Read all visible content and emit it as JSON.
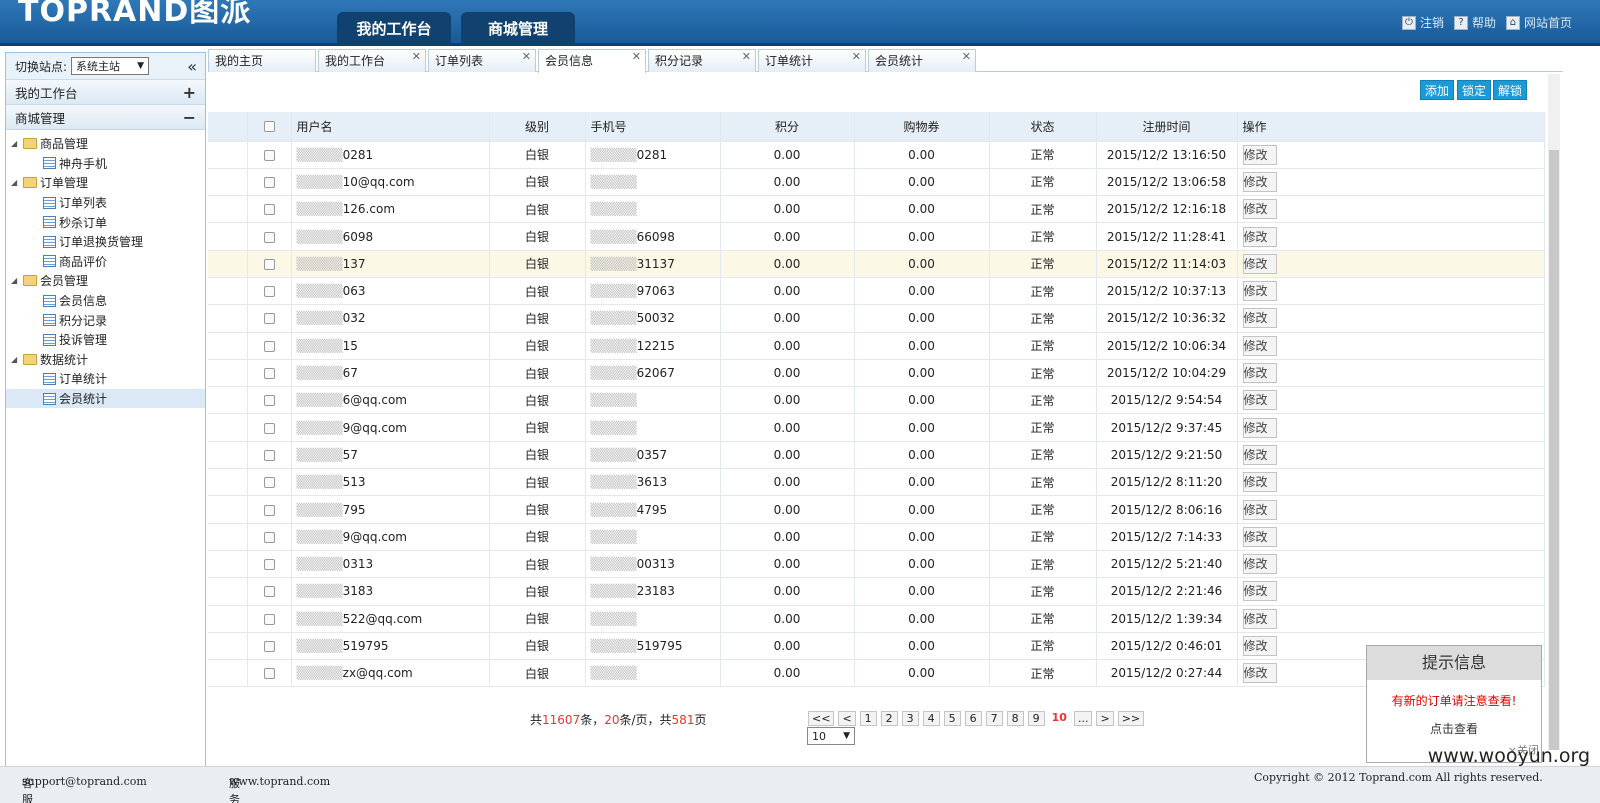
{
  "header": {
    "logo": "TOPRAND图派",
    "tabs": [
      {
        "label": "我的工作台"
      },
      {
        "label": "商城管理"
      }
    ],
    "links": [
      {
        "label": "注销",
        "icon": "power-icon"
      },
      {
        "label": "帮助",
        "icon": "help-icon"
      },
      {
        "label": "网站首页",
        "icon": "home-icon"
      }
    ]
  },
  "sidebar": {
    "site_label": "切换站点:",
    "site_value": "系统主站",
    "collapse_glyph": "«",
    "workbench": "我的工作台",
    "workbench_sign": "+",
    "mall": "商城管理",
    "mall_sign": "−",
    "tree": [
      {
        "label": "商品管理",
        "children": [
          {
            "label": "神舟手机"
          }
        ]
      },
      {
        "label": "订单管理",
        "children": [
          {
            "label": "订单列表"
          },
          {
            "label": "秒杀订单"
          },
          {
            "label": "订单退换货管理"
          },
          {
            "label": "商品评价"
          }
        ]
      },
      {
        "label": "会员管理",
        "children": [
          {
            "label": "会员信息"
          },
          {
            "label": "积分记录"
          },
          {
            "label": "投诉管理"
          }
        ]
      },
      {
        "label": "数据统计",
        "children": [
          {
            "label": "订单统计"
          },
          {
            "label": "会员统计"
          }
        ]
      }
    ]
  },
  "content_tabs": [
    {
      "label": "我的主页",
      "closable": false
    },
    {
      "label": "我的工作台",
      "closable": true
    },
    {
      "label": "订单列表",
      "closable": true
    },
    {
      "label": "会员信息",
      "closable": true,
      "active": true
    },
    {
      "label": "积分记录",
      "closable": true
    },
    {
      "label": "订单统计",
      "closable": true
    },
    {
      "label": "会员统计",
      "closable": true
    }
  ],
  "actions": {
    "add": "添加",
    "lock": "锁定",
    "unlock": "解锁"
  },
  "table": {
    "columns": [
      "用户名",
      "级别",
      "手机号",
      "积分",
      "购物券",
      "状态",
      "注册时间",
      "操作"
    ],
    "edit_label": "修改",
    "rows": [
      {
        "user": "0281",
        "level": "白银",
        "phone": "0281",
        "points": "0.00",
        "coupon": "0.00",
        "status": "正常",
        "time": "2015/12/2 13:16:50"
      },
      {
        "user": "10@qq.com",
        "level": "白银",
        "phone": "",
        "points": "0.00",
        "coupon": "0.00",
        "status": "正常",
        "time": "2015/12/2 13:06:58"
      },
      {
        "user": "126.com",
        "level": "白银",
        "phone": "",
        "points": "0.00",
        "coupon": "0.00",
        "status": "正常",
        "time": "2015/12/2 12:16:18"
      },
      {
        "user": "6098",
        "level": "白银",
        "phone": "66098",
        "points": "0.00",
        "coupon": "0.00",
        "status": "正常",
        "time": "2015/12/2 11:28:41"
      },
      {
        "user": "137",
        "level": "白银",
        "phone": "31137",
        "points": "0.00",
        "coupon": "0.00",
        "status": "正常",
        "time": "2015/12/2 11:14:03"
      },
      {
        "user": "063",
        "level": "白银",
        "phone": "97063",
        "points": "0.00",
        "coupon": "0.00",
        "status": "正常",
        "time": "2015/12/2 10:37:13"
      },
      {
        "user": "032",
        "level": "白银",
        "phone": "50032",
        "points": "0.00",
        "coupon": "0.00",
        "status": "正常",
        "time": "2015/12/2 10:36:32"
      },
      {
        "user": "15",
        "level": "白银",
        "phone": "12215",
        "points": "0.00",
        "coupon": "0.00",
        "status": "正常",
        "time": "2015/12/2 10:06:34"
      },
      {
        "user": "67",
        "level": "白银",
        "phone": "62067",
        "points": "0.00",
        "coupon": "0.00",
        "status": "正常",
        "time": "2015/12/2 10:04:29"
      },
      {
        "user": "6@qq.com",
        "level": "白银",
        "phone": "",
        "points": "0.00",
        "coupon": "0.00",
        "status": "正常",
        "time": "2015/12/2 9:54:54"
      },
      {
        "user": "9@qq.com",
        "level": "白银",
        "phone": "",
        "points": "0.00",
        "coupon": "0.00",
        "status": "正常",
        "time": "2015/12/2 9:37:45"
      },
      {
        "user": "57",
        "level": "白银",
        "phone": "0357",
        "points": "0.00",
        "coupon": "0.00",
        "status": "正常",
        "time": "2015/12/2 9:21:50"
      },
      {
        "user": "513",
        "level": "白银",
        "phone": "3613",
        "points": "0.00",
        "coupon": "0.00",
        "status": "正常",
        "time": "2015/12/2 8:11:20"
      },
      {
        "user": "795",
        "level": "白银",
        "phone": "4795",
        "points": "0.00",
        "coupon": "0.00",
        "status": "正常",
        "time": "2015/12/2 8:06:16"
      },
      {
        "user": "9@qq.com",
        "level": "白银",
        "phone": "",
        "points": "0.00",
        "coupon": "0.00",
        "status": "正常",
        "time": "2015/12/2 7:14:33"
      },
      {
        "user": "0313",
        "level": "白银",
        "phone": "00313",
        "points": "0.00",
        "coupon": "0.00",
        "status": "正常",
        "time": "2015/12/2 5:21:40"
      },
      {
        "user": "3183",
        "level": "白银",
        "phone": "23183",
        "points": "0.00",
        "coupon": "0.00",
        "status": "正常",
        "time": "2015/12/2 2:21:46"
      },
      {
        "user": "522@qq.com",
        "level": "白银",
        "phone": "",
        "points": "0.00",
        "coupon": "0.00",
        "status": "正常",
        "time": "2015/12/2 1:39:34"
      },
      {
        "user": "519795",
        "level": "白银",
        "phone": "519795",
        "points": "0.00",
        "coupon": "0.00",
        "status": "正常",
        "time": "2015/12/2 0:46:01"
      },
      {
        "user": "zx@qq.com",
        "level": "白银",
        "phone": "",
        "points": "0.00",
        "coupon": "0.00",
        "status": "正常",
        "time": "2015/12/2 0:27:44"
      }
    ],
    "highlighted_row": 4
  },
  "pager": {
    "prefix": "共",
    "total": "11607",
    "mid1": "条，",
    "per_page": "20",
    "mid2": "条/页，共",
    "pages": "581",
    "suffix": "页",
    "buttons": [
      "<<",
      "<",
      "1",
      "2",
      "3",
      "4",
      "5",
      "6",
      "7",
      "8",
      "9",
      "10",
      "...",
      ">",
      ">>"
    ],
    "current": "10",
    "page_size": "10"
  },
  "notice": {
    "title": "提示信息",
    "message": "有新的订单请注意查看!",
    "link": "点击查看",
    "close": "×关闭"
  },
  "footer": {
    "email_label": "客服邮箱:",
    "email": "support@toprand.com",
    "site_label": "服务网站:",
    "site": "www.toprand.com",
    "copyright": "Copyright © 2012 Toprand.com All rights reserved."
  },
  "watermark": "www.wooyun.org",
  "colors": {
    "header": "#1a5a98",
    "accent": "#1a9ad6",
    "highlight_row": "#fcf8e6",
    "red": "#e33"
  }
}
